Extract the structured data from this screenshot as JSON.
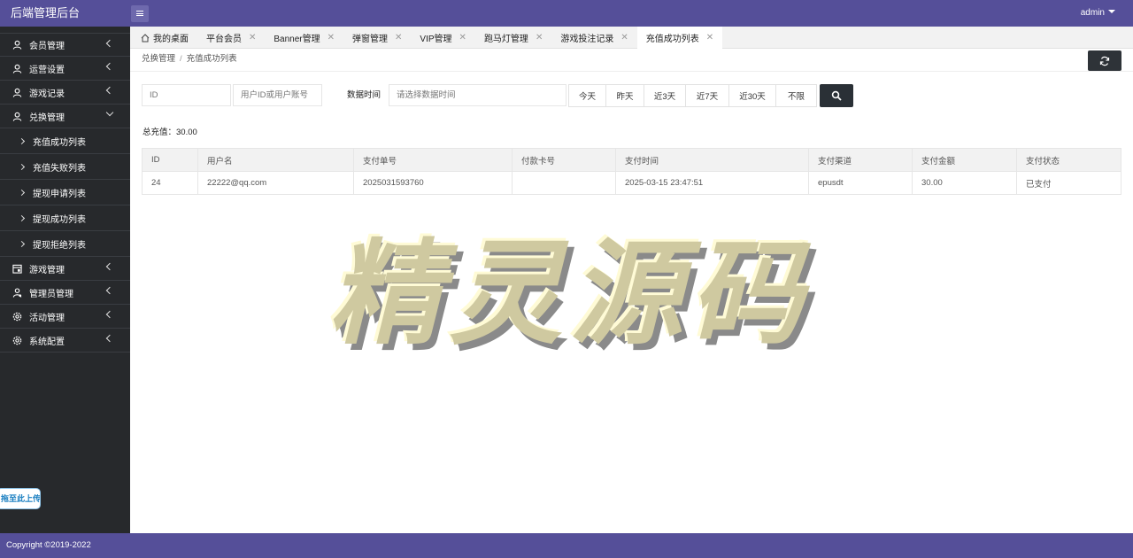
{
  "header": {
    "brand": "后端管理后台",
    "user": "admin"
  },
  "sidebar": {
    "items": [
      {
        "label": "会员管理",
        "icon": "user-icon"
      },
      {
        "label": "运营设置",
        "icon": "user-icon"
      },
      {
        "label": "游戏记录",
        "icon": "user-icon"
      },
      {
        "label": "兑换管理",
        "icon": "user-icon",
        "open": true,
        "children": [
          "充值成功列表",
          "充值失败列表",
          "提现申请列表",
          "提现成功列表",
          "提现拒绝列表"
        ]
      },
      {
        "label": "游戏管理",
        "icon": "calendar-icon"
      },
      {
        "label": "管理员管理",
        "icon": "admin-icon"
      },
      {
        "label": "活动管理",
        "icon": "gear-icon"
      },
      {
        "label": "系统配置",
        "icon": "gear-icon"
      }
    ],
    "upload_tab": "拖至此上传"
  },
  "tabs": [
    {
      "label": "我的桌面",
      "closable": false
    },
    {
      "label": "平台会员",
      "closable": true
    },
    {
      "label": "Banner管理",
      "closable": true
    },
    {
      "label": "弹窗管理",
      "closable": true
    },
    {
      "label": "VIP管理",
      "closable": true
    },
    {
      "label": "跑马灯管理",
      "closable": true
    },
    {
      "label": "游戏投注记录",
      "closable": true
    },
    {
      "label": "充值成功列表",
      "closable": true,
      "active": true
    }
  ],
  "breadcrumb": {
    "parent": "兑换管理",
    "sep": "/",
    "current": "充值成功列表"
  },
  "filters": {
    "id_placeholder": "ID",
    "user_placeholder": "用户ID或用户账号",
    "date_label": "数据时间",
    "date_placeholder": "请选择数据时间",
    "ranges": [
      "今天",
      "昨天",
      "近3天",
      "近7天",
      "近30天",
      "不限"
    ]
  },
  "summary": {
    "total": "总充值：30.00"
  },
  "table": {
    "columns": [
      "ID",
      "用户名",
      "支付单号",
      "付款卡号",
      "支付时间",
      "支付渠道",
      "支付金额",
      "支付状态"
    ],
    "rows": [
      [
        "24",
        "22222@qq.com",
        "2025031593760",
        "",
        "2025-03-15 23:47:51",
        "epusdt",
        "30.00",
        "已支付"
      ]
    ]
  },
  "watermark": "精灵源码",
  "footer": {
    "copyright": "Copyright ©2019-2022"
  },
  "colors": {
    "header": "#554f99",
    "sidebar": "#27292c",
    "dark_button": "#2a3036",
    "watermark_fill": "#cfc9a0",
    "watermark_shadow": "#8a8a8a"
  }
}
